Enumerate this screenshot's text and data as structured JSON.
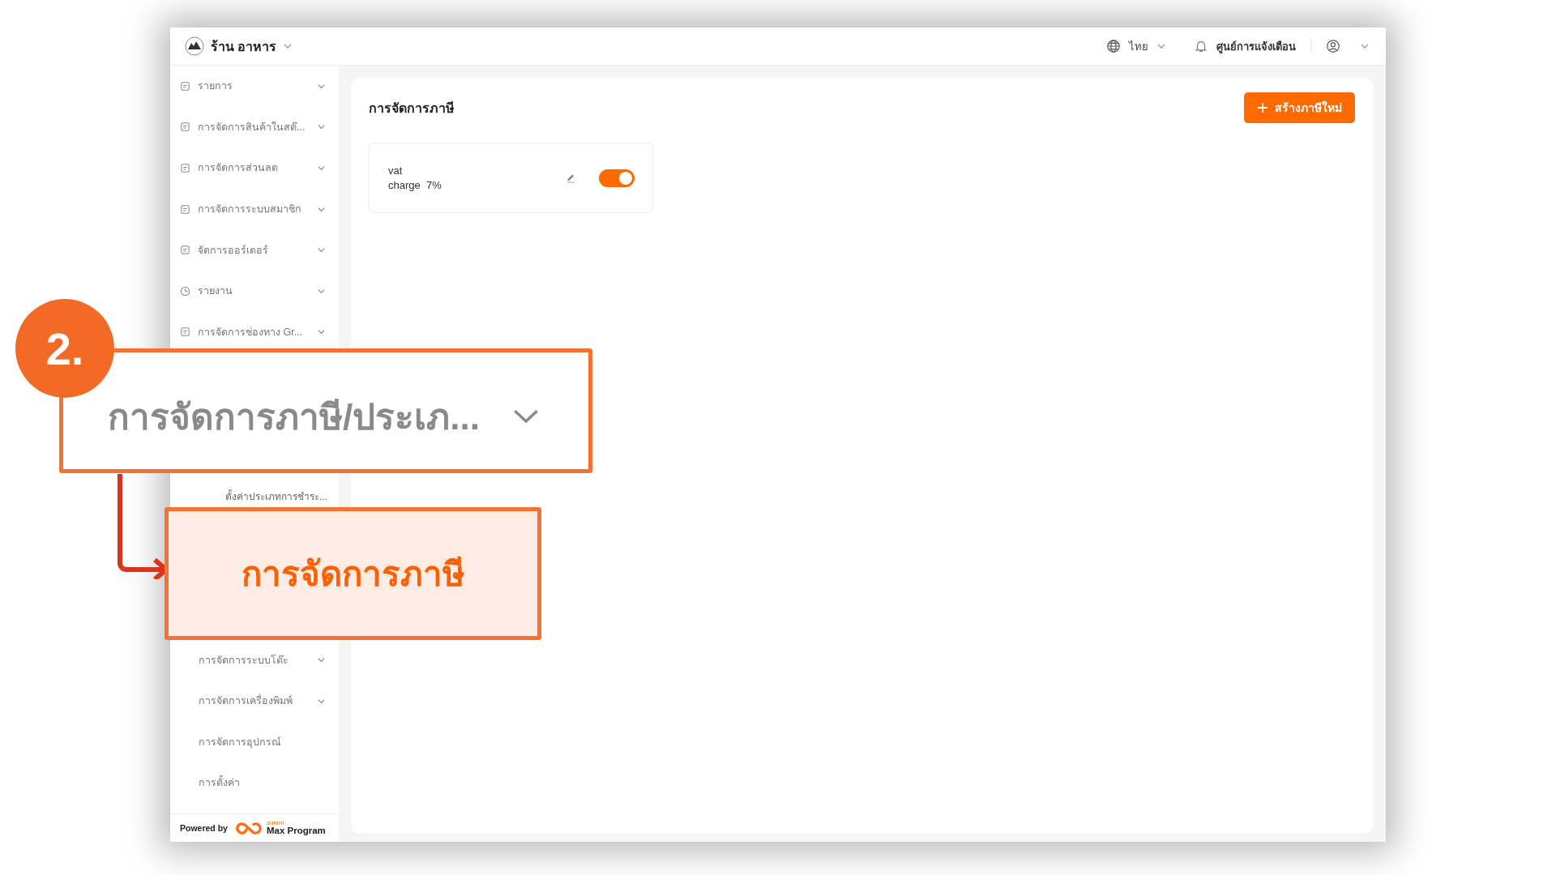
{
  "header": {
    "store_name": "ร้าน อาหาร",
    "language": "ไทย",
    "notifications": "ศูนย์การแจ้งเตือน"
  },
  "sidebar": {
    "items": [
      {
        "label": "รายการ"
      },
      {
        "label": "การจัดการสินค้าในสต๊..."
      },
      {
        "label": "การจัดการส่วนลด"
      },
      {
        "label": "การจัดการระบบสมาชิก"
      },
      {
        "label": "จัดการออร์เดอร์"
      },
      {
        "label": "รายงาน"
      },
      {
        "label": "การจัดการช่องทาง Gr..."
      }
    ],
    "submenu_item": "ตั้งค่าประเภทการชำระ...",
    "lower_items": [
      {
        "label": "การจัดการระบบโต๊ะ",
        "kind": "group"
      },
      {
        "label": "การจัดการเครื่องพิมพ์",
        "kind": "group"
      },
      {
        "label": "การจัดการอุปกรณ์",
        "kind": "link"
      },
      {
        "label": "การตั้งค่า",
        "kind": "link"
      }
    ],
    "footer": {
      "powered_by": "Powered by",
      "brand_small": "sunmi",
      "brand": "Max Program"
    }
  },
  "main": {
    "title": "การจัดการภาษี",
    "create_button": "สร้างภาษีใหม่",
    "taxes": [
      {
        "name": "vat",
        "label": "charge",
        "rate": "7%",
        "on": true
      }
    ]
  },
  "annotation": {
    "step": "2.",
    "menu_zoom": "การจัดการภาษี/ประเภ...",
    "target": "การจัดการภาษี"
  }
}
